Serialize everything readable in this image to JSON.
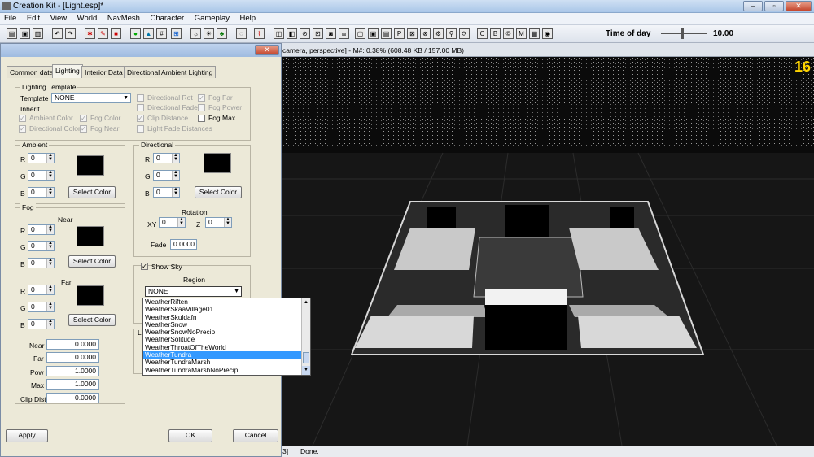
{
  "window": {
    "title": "Creation Kit - [Light.esp]*"
  },
  "menu": [
    "File",
    "Edit",
    "View",
    "World",
    "NavMesh",
    "Character",
    "Gameplay",
    "Help"
  ],
  "toolbar": {
    "time_label": "Time of day",
    "time_value": "10.00"
  },
  "viewport": {
    "header": "camera, perspective] - M#: 0.38% (608.48 KB / 157.00 MB)",
    "fps": "16"
  },
  "status": {
    "left": "3]",
    "text": "Done."
  },
  "dialog": {
    "tabs": [
      "Common data",
      "Lighting",
      "Interior Data",
      "Directional Ambient Lighting"
    ],
    "lighting_template": {
      "group": "Lighting Template",
      "template_label": "Template",
      "template_value": "NONE",
      "inherit_label": "Inherit",
      "checks": [
        {
          "label": "Ambient Color",
          "checked": true
        },
        {
          "label": "Fog Color",
          "checked": true
        },
        {
          "label": "Directional Color",
          "checked": true
        },
        {
          "label": "Fog Near",
          "checked": true
        },
        {
          "label": "Directional Rot",
          "checked": false
        },
        {
          "label": "Directional Fade",
          "checked": false
        },
        {
          "label": "Clip Distance",
          "checked": true
        },
        {
          "label": "Light Fade Distances",
          "checked": false
        },
        {
          "label": "Fog Far",
          "checked": true
        },
        {
          "label": "Fog Power",
          "checked": false
        },
        {
          "label": "Fog Max",
          "checked": false
        }
      ]
    },
    "ambient": {
      "group": "Ambient",
      "r": "0",
      "g": "0",
      "b": "0",
      "select": "Select Color"
    },
    "directional": {
      "group": "Directional",
      "r": "0",
      "g": "0",
      "b": "0",
      "select": "Select Color",
      "rotation": "Rotation",
      "xy_label": "XY",
      "xy": "0",
      "z_label": "Z",
      "z": "0",
      "fade_label": "Fade",
      "fade": "0.0000"
    },
    "fog": {
      "group": "Fog",
      "near_label": "Near",
      "far_label": "Far",
      "near_r": "0",
      "near_g": "0",
      "near_b": "0",
      "far_r": "0",
      "far_g": "0",
      "far_b": "0",
      "select_near": "Select Color",
      "select_far": "Select Color",
      "near": "0.0000",
      "far": "0.0000",
      "pow": "1.0000",
      "max": "1.0000",
      "clip": "0.0000",
      "labels": {
        "near": "Near",
        "far": "Far",
        "pow": "Pow",
        "max": "Max",
        "clip": "Clip Dist"
      }
    },
    "rgb": {
      "r": "R",
      "g": "G",
      "b": "B"
    },
    "show_sky": {
      "label": "Show Sky",
      "checked": true,
      "region_label": "Region",
      "region_value": "NONE",
      "li": "Li"
    },
    "dropdown": [
      "WeatherRiften",
      "WeatherSkaaVillage01",
      "WeatherSkuldafn",
      "WeatherSnow",
      "WeatherSnowNoPrecip",
      "WeatherSolitude",
      "WeatherThroatOfTheWorld",
      "WeatherTundra",
      "WeatherTundraMarsh",
      "WeatherTundraMarshNoPrecip"
    ],
    "dropdown_selected": "WeatherTundra",
    "buttons": {
      "apply": "Apply",
      "ok": "OK",
      "cancel": "Cancel"
    }
  },
  "colors": {
    "selection": "#3399ff",
    "fps": "#ffd400"
  }
}
